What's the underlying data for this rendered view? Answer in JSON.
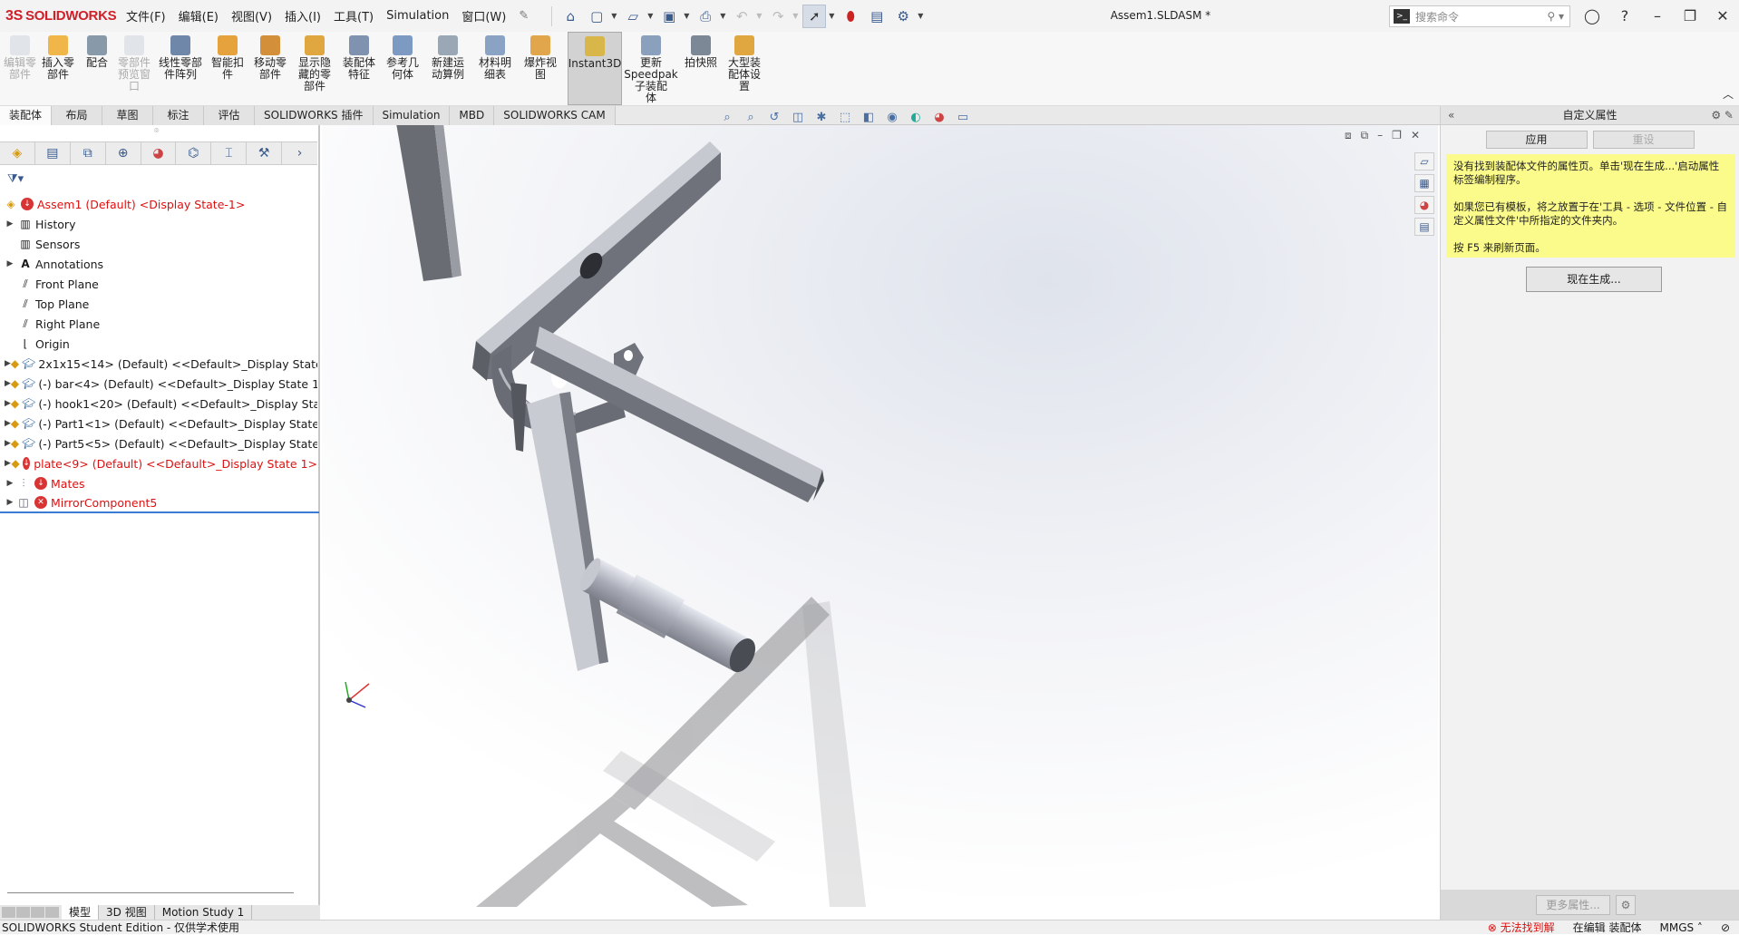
{
  "app": {
    "brand": "SOLIDWORKS",
    "brand_prefix": "3S",
    "doc_title": "Assem1.SLDASM *"
  },
  "menu": [
    "文件(F)",
    "编辑(E)",
    "视图(V)",
    "插入(I)",
    "工具(T)",
    "Simulation",
    "窗口(W)"
  ],
  "search": {
    "placeholder": "搜索命令"
  },
  "ribbon": [
    {
      "label": "编辑零\n部件",
      "disabled": true
    },
    {
      "label": "插入零\n部件",
      "disabled": false
    },
    {
      "label": "配合",
      "disabled": false
    },
    {
      "label": "零部件\n预览窗\n口",
      "disabled": true
    },
    {
      "label": "线性零部\n件阵列",
      "disabled": false
    },
    {
      "label": "智能扣\n件",
      "disabled": false
    },
    {
      "label": "移动零\n部件",
      "disabled": false
    },
    {
      "label": "显示隐\n藏的零\n部件",
      "disabled": false
    },
    {
      "label": "装配体\n特征",
      "disabled": false
    },
    {
      "label": "参考几\n何体",
      "disabled": false
    },
    {
      "label": "新建运\n动算例",
      "disabled": false
    },
    {
      "label": "材料明\n细表",
      "disabled": false
    },
    {
      "label": "爆炸视\n图",
      "disabled": false
    },
    {
      "label": "Instant3D",
      "disabled": false,
      "active": true
    },
    {
      "label": "更新\nSpeedpak\n子装配\n体",
      "disabled": false
    },
    {
      "label": "拍快照",
      "disabled": false
    },
    {
      "label": "大型装\n配体设\n置",
      "disabled": false
    }
  ],
  "tabs": [
    "装配体",
    "布局",
    "草图",
    "标注",
    "评估",
    "SOLIDWORKS 插件",
    "Simulation",
    "MBD",
    "SOLIDWORKS CAM"
  ],
  "tree": {
    "root": "Assem1 (Default) <Display State-1>",
    "items": [
      {
        "label": "History",
        "type": "folder"
      },
      {
        "label": "Sensors",
        "type": "folder"
      },
      {
        "label": "Annotations",
        "type": "folder"
      },
      {
        "label": "Front Plane",
        "type": "plane"
      },
      {
        "label": "Top Plane",
        "type": "plane"
      },
      {
        "label": "Right Plane",
        "type": "plane"
      },
      {
        "label": "Origin",
        "type": "origin"
      },
      {
        "label": "2x1x15<14> (Default) <<Default>_Display State",
        "type": "part"
      },
      {
        "label": "(-) bar<4> (Default) <<Default>_Display State 1",
        "type": "part"
      },
      {
        "label": "(-) hook1<20> (Default) <<Default>_Display Sta",
        "type": "part"
      },
      {
        "label": "(-) Part1<1> (Default) <<Default>_Display State",
        "type": "part"
      },
      {
        "label": "(-) Part5<5> (Default) <<Default>_Display State",
        "type": "part"
      },
      {
        "label": "plate<9> (Default) <<Default>_Display State 1>",
        "type": "part-error"
      },
      {
        "label": "Mates",
        "type": "mates-error"
      },
      {
        "label": "MirrorComponent5",
        "type": "mirror-error"
      }
    ]
  },
  "bottom_tabs": [
    "模型",
    "3D 视图",
    "Motion Study 1"
  ],
  "right_panel": {
    "title": "自定义属性",
    "apply": "应用",
    "reset": "重设",
    "note_1": "没有找到装配体文件的属性页。单击'现在生成...'启动属性标签编制程序。",
    "note_2": "如果您已有模板，将之放置于在'工具 - 选项 - 文件位置 - 自定义属性文件'中所指定的文件夹内。",
    "note_3": "按 F5 来刷新页面。",
    "generate": "现在生成...",
    "more": "更多属性..."
  },
  "status": {
    "left": "SOLIDWORKS Student Edition - 仅供学术使用",
    "error": "无法找到解",
    "mode": "在编辑 装配体",
    "units": "MMGS"
  },
  "colors": {
    "brand_red": "#d0202a",
    "note_yellow": "#fbfb8c",
    "part_gray": "#7d7f86"
  }
}
